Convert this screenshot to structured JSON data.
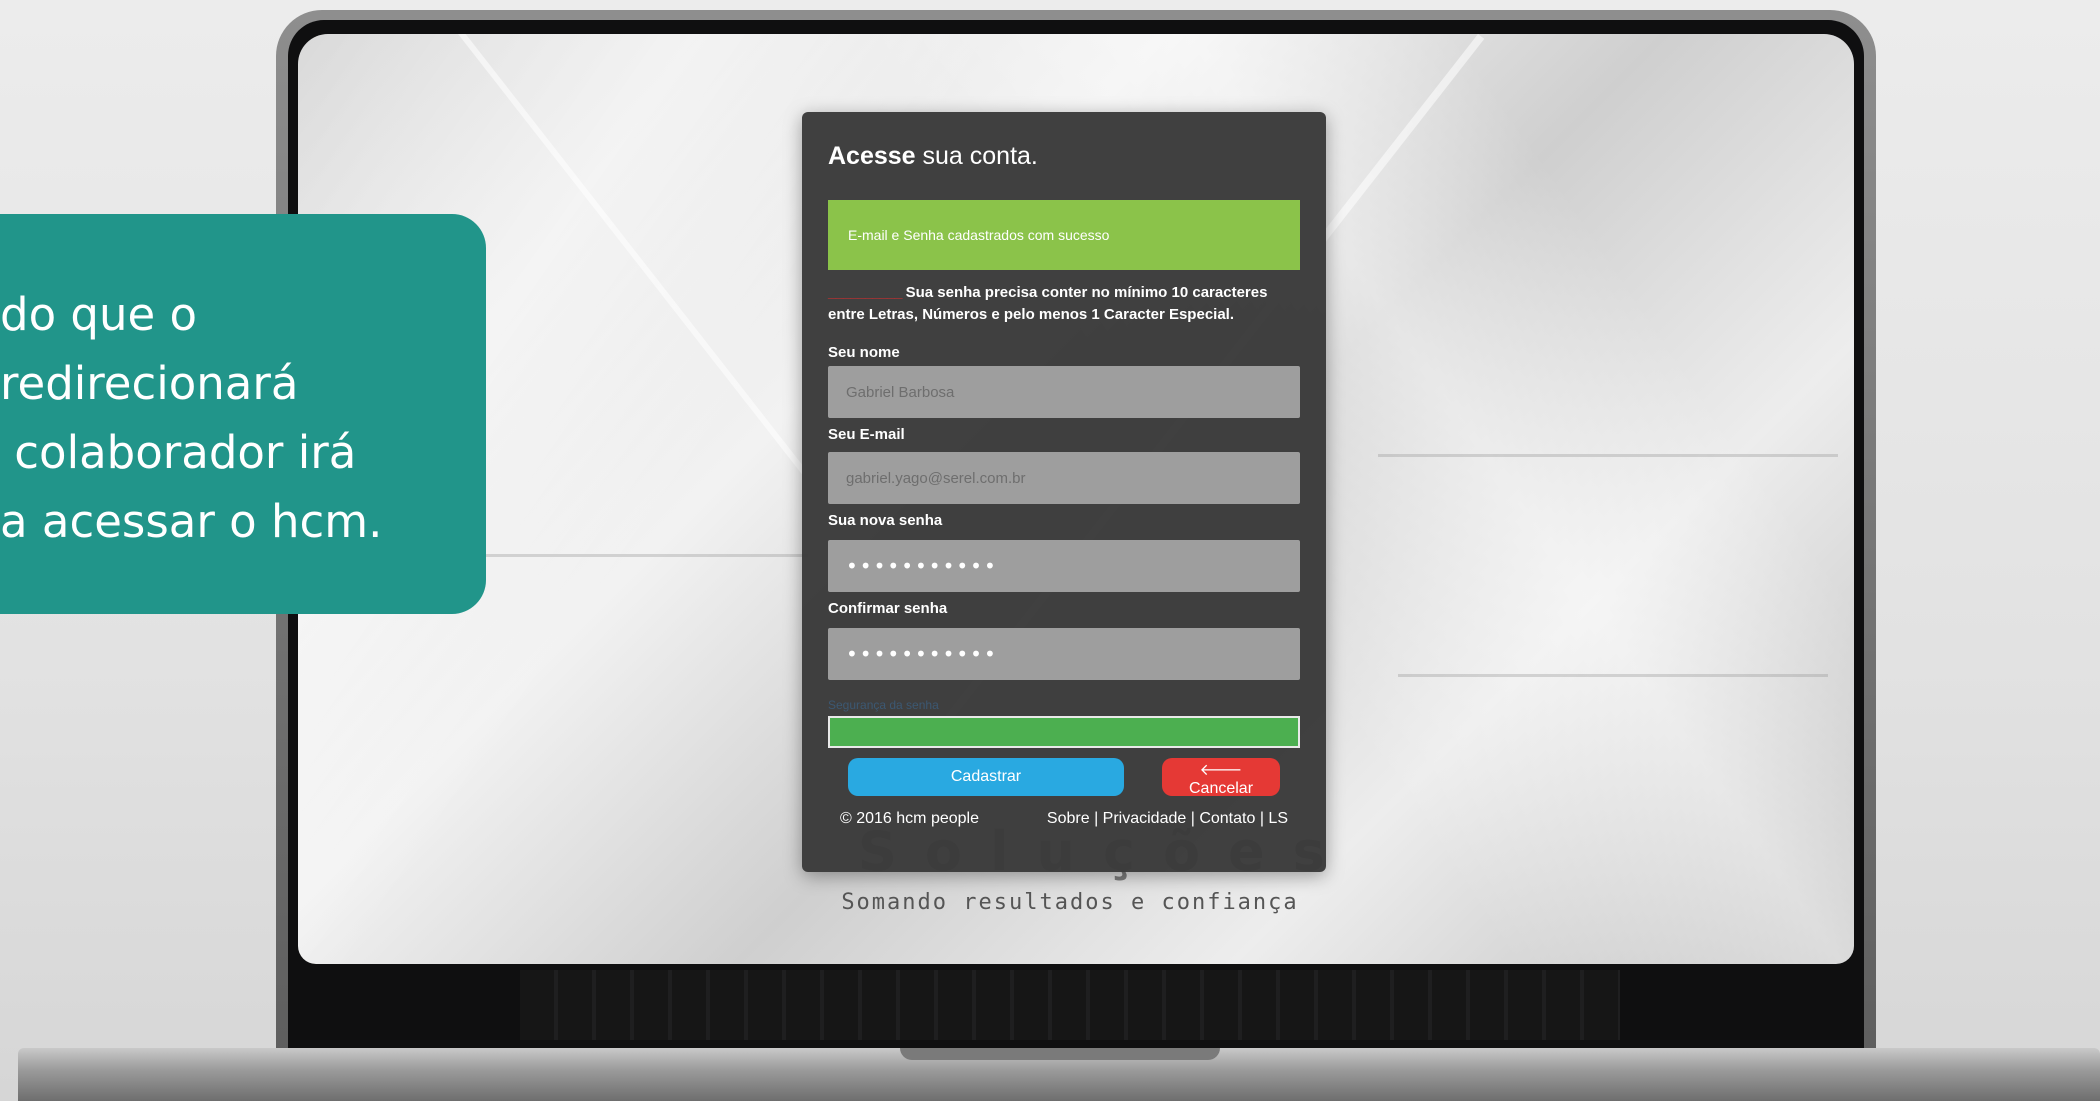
{
  "login": {
    "title_bold": "Acesse",
    "title_rest": " sua conta.",
    "success_message": "E-mail e Senha cadastrados com sucesso",
    "hint_label": "__________",
    "hint_text": " Sua senha precisa conter no mínimo 10 caracteres entre Letras, Números e pelo menos 1 Caracter Especial.",
    "fields": {
      "name_label": "Seu nome",
      "name_value": "Gabriel Barbosa",
      "email_label": "Seu E-mail",
      "email_value": "gabriel.yago@serel.com.br",
      "new_password_label": "Sua nova senha",
      "new_password_value": "•••••••••••",
      "confirm_password_label": "Confirmar senha",
      "confirm_password_value": "•••••••••••"
    },
    "strength_label": "Segurança da senha",
    "strength_level": 1.0,
    "buttons": {
      "submit": "Cadastrar",
      "cancel_icon": "arrow-left-icon",
      "cancel": "Cancelar"
    },
    "footer": {
      "copyright": "© 2016 hcm people",
      "links": [
        "Sobre",
        "Privacidade",
        "Contato",
        "LS"
      ]
    }
  },
  "background_brand": {
    "logo_text": "Soluções",
    "tagline": "Somando resultados e confiança"
  },
  "callout": {
    "text": "do que o\nredirecionará\n colaborador irá\na acessar o hcm."
  },
  "colors": {
    "callout_bg": "#21958a",
    "success_green": "#8bc34a",
    "strength_green": "#4caf50",
    "submit_blue": "#29a9e1",
    "cancel_red": "#e53935",
    "card_bg": "#3a3a3a"
  }
}
